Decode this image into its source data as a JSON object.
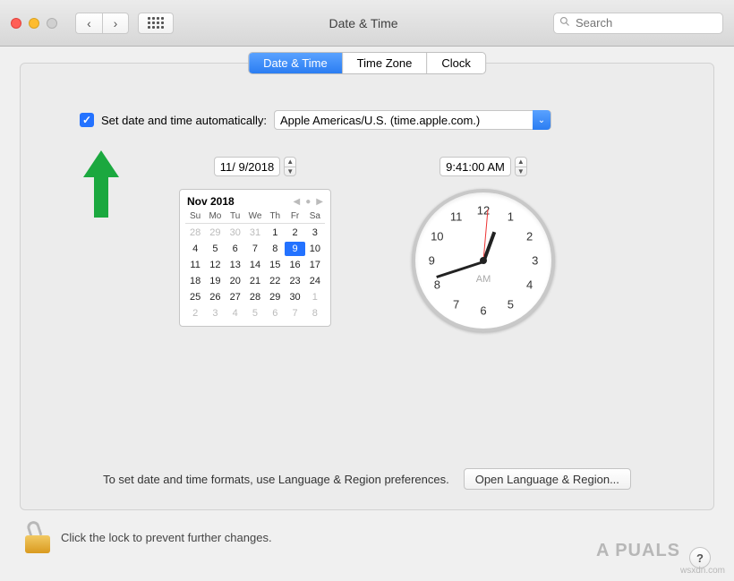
{
  "window": {
    "title": "Date & Time"
  },
  "toolbar": {
    "search_placeholder": "Search"
  },
  "tabs": {
    "t0": "Date & Time",
    "t1": "Time Zone",
    "t2": "Clock"
  },
  "auto": {
    "label": "Set date and time automatically:",
    "server": "Apple Americas/U.S. (time.apple.com.)"
  },
  "date_field": "11/  9/2018",
  "time_field": "9:41:00 AM",
  "calendar": {
    "title": "Nov 2018",
    "dow": {
      "0": "Su",
      "1": "Mo",
      "2": "Tu",
      "3": "We",
      "4": "Th",
      "5": "Fr",
      "6": "Sa"
    },
    "cells": {
      "0": "28",
      "1": "29",
      "2": "30",
      "3": "31",
      "4": "1",
      "5": "2",
      "6": "3",
      "7": "4",
      "8": "5",
      "9": "6",
      "10": "7",
      "11": "8",
      "12": "9",
      "13": "10",
      "14": "11",
      "15": "12",
      "16": "13",
      "17": "14",
      "18": "15",
      "19": "16",
      "20": "17",
      "21": "18",
      "22": "19",
      "23": "20",
      "24": "21",
      "25": "22",
      "26": "23",
      "27": "24",
      "28": "25",
      "29": "26",
      "30": "27",
      "31": "28",
      "32": "29",
      "33": "30",
      "34": "1",
      "35": "2",
      "36": "3",
      "37": "4",
      "38": "5",
      "39": "6",
      "40": "7",
      "41": "8"
    },
    "other_month": [
      0,
      1,
      2,
      3,
      34,
      35,
      36,
      37,
      38,
      39,
      40,
      41
    ],
    "selected": 12
  },
  "clock": {
    "ampm": "AM",
    "n12": "12",
    "n1": "1",
    "n2": "2",
    "n3": "3",
    "n4": "4",
    "n5": "5",
    "n6": "6",
    "n7": "7",
    "n8": "8",
    "n9": "9",
    "n10": "10",
    "n11": "11"
  },
  "format_hint": "To set date and time formats, use Language & Region preferences.",
  "open_lr_btn": "Open Language & Region...",
  "lock_text": "Click the lock to prevent further changes.",
  "help": "?",
  "watermark": "A   PUALS",
  "watermark_src": "wsxdn.com"
}
